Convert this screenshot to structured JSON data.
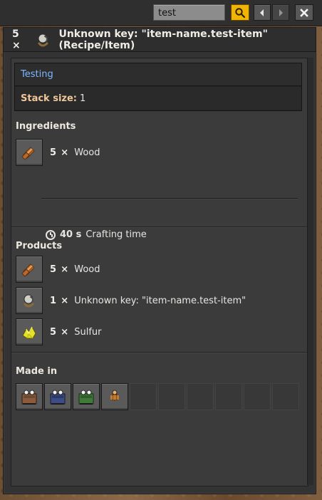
{
  "toolbar": {
    "search_value": "test",
    "icons": {
      "search": "search-icon",
      "back": "arrow-left-icon",
      "forward": "arrow-right-icon",
      "close": "close-icon"
    },
    "colors": {
      "accent": "#f1b400"
    }
  },
  "header": {
    "qty": "5",
    "times": "×",
    "title": "Unknown key: \"item-name.test-item\" (Recipe/Item)"
  },
  "info": {
    "testing_link": "Testing",
    "stack_size_label": "Stack size:",
    "stack_size_value": "1"
  },
  "ingredients": {
    "title": "Ingredients",
    "items": [
      {
        "qty": "5",
        "name": "Wood",
        "icon": "wood-icon"
      }
    ],
    "crafting_time_value": "40 s",
    "crafting_time_label": "Crafting time"
  },
  "products": {
    "title": "Products",
    "items": [
      {
        "qty": "5",
        "name": "Wood",
        "icon": "wood-icon"
      },
      {
        "qty": "1",
        "name": "Unknown key: \"item-name.test-item\"",
        "icon": "test-item-icon"
      },
      {
        "qty": "5",
        "name": "Sulfur",
        "icon": "sulfur-icon"
      }
    ]
  },
  "made_in": {
    "title": "Made in",
    "machines": [
      {
        "icon": "assembler-1-icon"
      },
      {
        "icon": "assembler-2-icon"
      },
      {
        "icon": "assembler-3-icon"
      },
      {
        "icon": "character-icon"
      }
    ]
  }
}
